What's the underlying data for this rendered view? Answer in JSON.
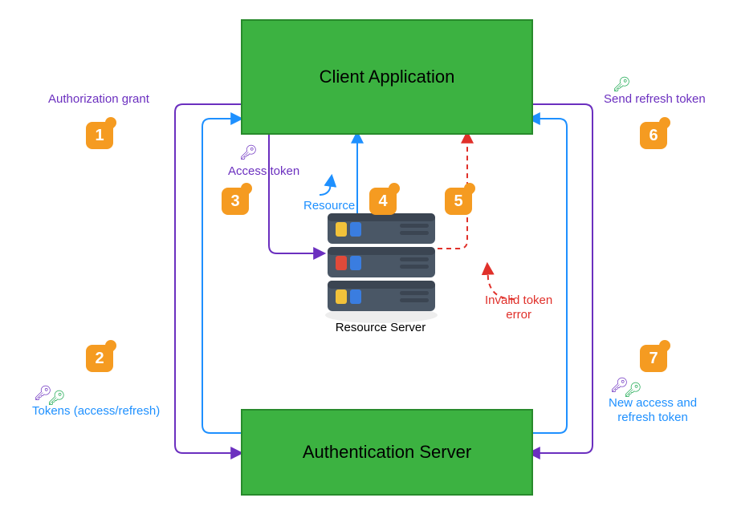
{
  "boxes": {
    "client": "Client Application",
    "auth": "Authentication Server",
    "resource_label": "Resource Server"
  },
  "steps": {
    "1": {
      "label": "Authorization grant",
      "color": "purple"
    },
    "2": {
      "label": "Tokens (access/refresh)",
      "color": "blue"
    },
    "3": {
      "label": "Access token",
      "color": "purple"
    },
    "4": {
      "label": "Resource",
      "color": "blue"
    },
    "5": {
      "label": "Invalid token\nerror",
      "color": "red"
    },
    "6": {
      "label": "Send refresh token",
      "color": "purple"
    },
    "7": {
      "label": "New access and\nrefresh token",
      "color": "blue"
    }
  },
  "colors": {
    "purple": "#6b2fbf",
    "blue": "#1e90ff",
    "red": "#e0302a",
    "green": "#1aa84f",
    "orange": "#f59b21",
    "boxFill": "#3cb241",
    "boxEdge": "#288a2c"
  }
}
